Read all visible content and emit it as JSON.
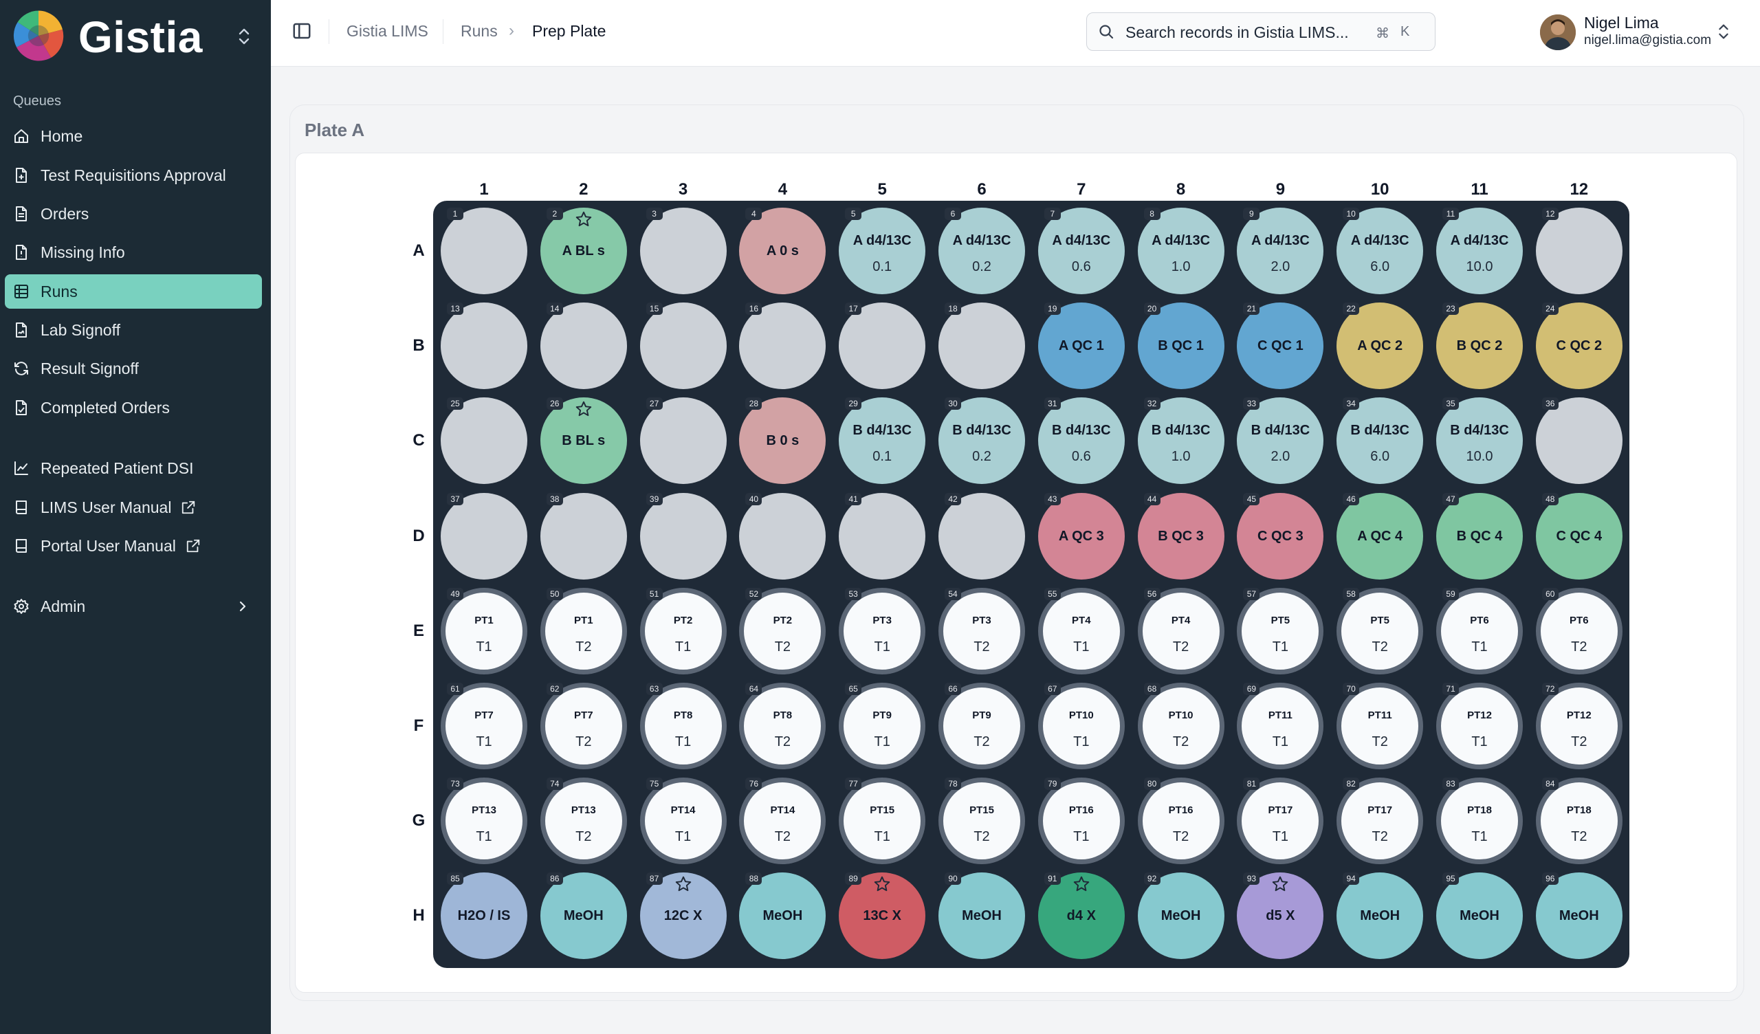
{
  "brand": {
    "name": "Gistia"
  },
  "sidebar": {
    "section_label": "Queues",
    "items": [
      {
        "label": "Home",
        "icon": "home-icon",
        "active": false,
        "external": false
      },
      {
        "label": "Test Requisitions Approval",
        "icon": "document-plus-icon",
        "active": false,
        "external": false
      },
      {
        "label": "Orders",
        "icon": "document-icon",
        "active": false,
        "external": false
      },
      {
        "label": "Missing Info",
        "icon": "document-alert-icon",
        "active": false,
        "external": false
      },
      {
        "label": "Runs",
        "icon": "table-grid-icon",
        "active": true,
        "external": false
      },
      {
        "label": "Lab Signoff",
        "icon": "document-signature-icon",
        "active": false,
        "external": false
      },
      {
        "label": "Result Signoff",
        "icon": "refresh-icon",
        "active": false,
        "external": false
      },
      {
        "label": "Completed Orders",
        "icon": "document-check-icon",
        "active": false,
        "external": false
      },
      {
        "label": "Repeated Patient DSI",
        "icon": "chart-line-icon",
        "active": false,
        "external": false
      },
      {
        "label": "LIMS User Manual",
        "icon": "book-icon",
        "active": false,
        "external": true
      },
      {
        "label": "Portal User Manual",
        "icon": "book-icon",
        "active": false,
        "external": true
      },
      {
        "label": "Admin",
        "icon": "gear-icon",
        "active": false,
        "external": false,
        "has_chevron": true
      }
    ]
  },
  "breadcrumb": [
    "Gistia LIMS",
    "Runs",
    "Prep Plate"
  ],
  "search": {
    "placeholder": "Search records in Gistia LIMS...",
    "shortcut_symbol": "⌘",
    "shortcut_key": "K"
  },
  "user": {
    "name": "Nigel Lima",
    "email": "nigel.lima@gistia.com"
  },
  "plate": {
    "title": "Plate A",
    "columns": [
      "1",
      "2",
      "3",
      "4",
      "5",
      "6",
      "7",
      "8",
      "9",
      "10",
      "11",
      "12"
    ],
    "rows": [
      "A",
      "B",
      "C",
      "D",
      "E",
      "F",
      "G",
      "H"
    ],
    "colors": {
      "empty": "#ccd1d7",
      "blank": "#86c9a8",
      "zero": "#d2a2a4",
      "cal": "#a9cfd3",
      "qc_blue": "#62a6d1",
      "qc_gold": "#d2be73",
      "qc_pink": "#d38595",
      "qc_green": "#7fc6a1",
      "sample": "#f8fafc",
      "h2o": "#9eb6d7",
      "meoh": "#86c9cf",
      "c12": "#a1b8d8",
      "c13": "#cf5c64",
      "d4": "#37a77d",
      "d5": "#a79ad7"
    },
    "wells": [
      {
        "n": "1",
        "label": "",
        "type": "empty"
      },
      {
        "n": "2",
        "label": "A BL s",
        "type": "blank",
        "star": true
      },
      {
        "n": "3",
        "label": "",
        "type": "empty"
      },
      {
        "n": "4",
        "label": "A 0 s",
        "type": "zero"
      },
      {
        "n": "5",
        "label": "A d4/13C",
        "sub": "0.1",
        "type": "cal"
      },
      {
        "n": "6",
        "label": "A d4/13C",
        "sub": "0.2",
        "type": "cal"
      },
      {
        "n": "7",
        "label": "A d4/13C",
        "sub": "0.6",
        "type": "cal"
      },
      {
        "n": "8",
        "label": "A d4/13C",
        "sub": "1.0",
        "type": "cal"
      },
      {
        "n": "9",
        "label": "A d4/13C",
        "sub": "2.0",
        "type": "cal"
      },
      {
        "n": "10",
        "label": "A d4/13C",
        "sub": "6.0",
        "type": "cal"
      },
      {
        "n": "11",
        "label": "A d4/13C",
        "sub": "10.0",
        "type": "cal"
      },
      {
        "n": "12",
        "label": "",
        "type": "empty"
      },
      {
        "n": "13",
        "label": "",
        "type": "empty"
      },
      {
        "n": "14",
        "label": "",
        "type": "empty"
      },
      {
        "n": "15",
        "label": "",
        "type": "empty"
      },
      {
        "n": "16",
        "label": "",
        "type": "empty"
      },
      {
        "n": "17",
        "label": "",
        "type": "empty"
      },
      {
        "n": "18",
        "label": "",
        "type": "empty"
      },
      {
        "n": "19",
        "label": "A QC 1",
        "type": "qc_blue"
      },
      {
        "n": "20",
        "label": "B QC 1",
        "type": "qc_blue"
      },
      {
        "n": "21",
        "label": "C QC 1",
        "type": "qc_blue"
      },
      {
        "n": "22",
        "label": "A QC 2",
        "type": "qc_gold"
      },
      {
        "n": "23",
        "label": "B QC 2",
        "type": "qc_gold"
      },
      {
        "n": "24",
        "label": "C QC 2",
        "type": "qc_gold"
      },
      {
        "n": "25",
        "label": "",
        "type": "empty"
      },
      {
        "n": "26",
        "label": "B BL s",
        "type": "blank",
        "star": true
      },
      {
        "n": "27",
        "label": "",
        "type": "empty"
      },
      {
        "n": "28",
        "label": "B 0 s",
        "type": "zero"
      },
      {
        "n": "29",
        "label": "B d4/13C",
        "sub": "0.1",
        "type": "cal"
      },
      {
        "n": "30",
        "label": "B d4/13C",
        "sub": "0.2",
        "type": "cal"
      },
      {
        "n": "31",
        "label": "B d4/13C",
        "sub": "0.6",
        "type": "cal"
      },
      {
        "n": "32",
        "label": "B d4/13C",
        "sub": "1.0",
        "type": "cal"
      },
      {
        "n": "33",
        "label": "B d4/13C",
        "sub": "2.0",
        "type": "cal"
      },
      {
        "n": "34",
        "label": "B d4/13C",
        "sub": "6.0",
        "type": "cal"
      },
      {
        "n": "35",
        "label": "B d4/13C",
        "sub": "10.0",
        "type": "cal"
      },
      {
        "n": "36",
        "label": "",
        "type": "empty"
      },
      {
        "n": "37",
        "label": "",
        "type": "empty"
      },
      {
        "n": "38",
        "label": "",
        "type": "empty"
      },
      {
        "n": "39",
        "label": "",
        "type": "empty"
      },
      {
        "n": "40",
        "label": "",
        "type": "empty"
      },
      {
        "n": "41",
        "label": "",
        "type": "empty"
      },
      {
        "n": "42",
        "label": "",
        "type": "empty"
      },
      {
        "n": "43",
        "label": "A QC 3",
        "type": "qc_pink"
      },
      {
        "n": "44",
        "label": "B QC 3",
        "type": "qc_pink"
      },
      {
        "n": "45",
        "label": "C QC 3",
        "type": "qc_pink"
      },
      {
        "n": "46",
        "label": "A QC 4",
        "type": "qc_green"
      },
      {
        "n": "47",
        "label": "B QC 4",
        "type": "qc_green"
      },
      {
        "n": "48",
        "label": "C QC 4",
        "type": "qc_green"
      },
      {
        "n": "49",
        "label": "PT1",
        "sub": "T1",
        "type": "sample"
      },
      {
        "n": "50",
        "label": "PT1",
        "sub": "T2",
        "type": "sample"
      },
      {
        "n": "51",
        "label": "PT2",
        "sub": "T1",
        "type": "sample"
      },
      {
        "n": "52",
        "label": "PT2",
        "sub": "T2",
        "type": "sample"
      },
      {
        "n": "53",
        "label": "PT3",
        "sub": "T1",
        "type": "sample"
      },
      {
        "n": "54",
        "label": "PT3",
        "sub": "T2",
        "type": "sample"
      },
      {
        "n": "55",
        "label": "PT4",
        "sub": "T1",
        "type": "sample"
      },
      {
        "n": "56",
        "label": "PT4",
        "sub": "T2",
        "type": "sample"
      },
      {
        "n": "57",
        "label": "PT5",
        "sub": "T1",
        "type": "sample"
      },
      {
        "n": "58",
        "label": "PT5",
        "sub": "T2",
        "type": "sample"
      },
      {
        "n": "59",
        "label": "PT6",
        "sub": "T1",
        "type": "sample"
      },
      {
        "n": "60",
        "label": "PT6",
        "sub": "T2",
        "type": "sample"
      },
      {
        "n": "61",
        "label": "PT7",
        "sub": "T1",
        "type": "sample"
      },
      {
        "n": "62",
        "label": "PT7",
        "sub": "T2",
        "type": "sample"
      },
      {
        "n": "63",
        "label": "PT8",
        "sub": "T1",
        "type": "sample"
      },
      {
        "n": "64",
        "label": "PT8",
        "sub": "T2",
        "type": "sample"
      },
      {
        "n": "65",
        "label": "PT9",
        "sub": "T1",
        "type": "sample"
      },
      {
        "n": "66",
        "label": "PT9",
        "sub": "T2",
        "type": "sample"
      },
      {
        "n": "67",
        "label": "PT10",
        "sub": "T1",
        "type": "sample"
      },
      {
        "n": "68",
        "label": "PT10",
        "sub": "T2",
        "type": "sample"
      },
      {
        "n": "69",
        "label": "PT11",
        "sub": "T1",
        "type": "sample"
      },
      {
        "n": "70",
        "label": "PT11",
        "sub": "T2",
        "type": "sample"
      },
      {
        "n": "71",
        "label": "PT12",
        "sub": "T1",
        "type": "sample"
      },
      {
        "n": "72",
        "label": "PT12",
        "sub": "T2",
        "type": "sample"
      },
      {
        "n": "73",
        "label": "PT13",
        "sub": "T1",
        "type": "sample"
      },
      {
        "n": "74",
        "label": "PT13",
        "sub": "T2",
        "type": "sample"
      },
      {
        "n": "75",
        "label": "PT14",
        "sub": "T1",
        "type": "sample"
      },
      {
        "n": "76",
        "label": "PT14",
        "sub": "T2",
        "type": "sample"
      },
      {
        "n": "77",
        "label": "PT15",
        "sub": "T1",
        "type": "sample"
      },
      {
        "n": "78",
        "label": "PT15",
        "sub": "T2",
        "type": "sample"
      },
      {
        "n": "79",
        "label": "PT16",
        "sub": "T1",
        "type": "sample"
      },
      {
        "n": "80",
        "label": "PT16",
        "sub": "T2",
        "type": "sample"
      },
      {
        "n": "81",
        "label": "PT17",
        "sub": "T1",
        "type": "sample"
      },
      {
        "n": "82",
        "label": "PT17",
        "sub": "T2",
        "type": "sample"
      },
      {
        "n": "83",
        "label": "PT18",
        "sub": "T1",
        "type": "sample"
      },
      {
        "n": "84",
        "label": "PT18",
        "sub": "T2",
        "type": "sample"
      },
      {
        "n": "85",
        "label": "H2O / IS",
        "type": "h2o"
      },
      {
        "n": "86",
        "label": "MeOH",
        "type": "meoh"
      },
      {
        "n": "87",
        "label": "12C X",
        "type": "c12",
        "star": true
      },
      {
        "n": "88",
        "label": "MeOH",
        "type": "meoh"
      },
      {
        "n": "89",
        "label": "13C X",
        "type": "c13",
        "star": true
      },
      {
        "n": "90",
        "label": "MeOH",
        "type": "meoh"
      },
      {
        "n": "91",
        "label": "d4 X",
        "type": "d4",
        "star": true
      },
      {
        "n": "92",
        "label": "MeOH",
        "type": "meoh"
      },
      {
        "n": "93",
        "label": "d5 X",
        "type": "d5",
        "star": true
      },
      {
        "n": "94",
        "label": "MeOH",
        "type": "meoh"
      },
      {
        "n": "95",
        "label": "MeOH",
        "type": "meoh"
      },
      {
        "n": "96",
        "label": "MeOH",
        "type": "meoh"
      }
    ]
  }
}
